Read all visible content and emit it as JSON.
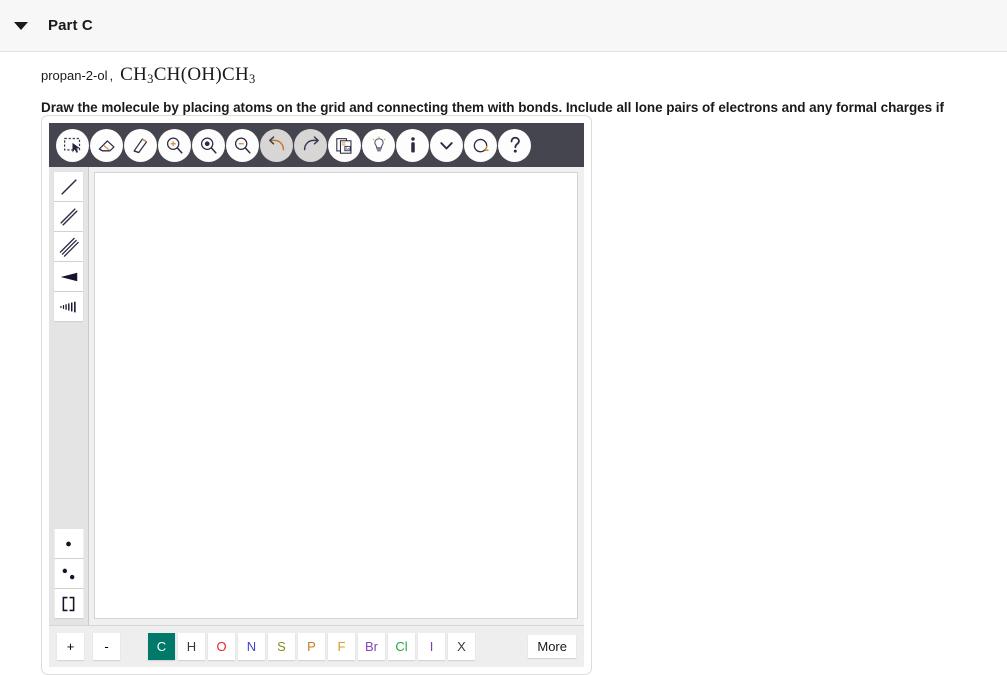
{
  "header": {
    "caret_icon": "caret-down-icon",
    "title": "Part C"
  },
  "prompt": {
    "compound_name": "propan-2-ol",
    "separator": ",",
    "formula_parts": [
      {
        "text": "CH",
        "sub": "3"
      },
      {
        "text": "CH(OH)CH",
        "sub": "3"
      }
    ],
    "formula_plain": "CH3CH(OH)CH3",
    "instruction": "Draw the molecule by placing atoms on the grid and connecting them with bonds. Include all lone pairs of electrons and any formal charges if necessary."
  },
  "editor": {
    "toolbar": [
      {
        "name": "select-lasso-icon",
        "label": "Select",
        "state": "enabled"
      },
      {
        "name": "eraser-icon",
        "label": "Erase",
        "state": "enabled"
      },
      {
        "name": "pencil-draw-icon",
        "label": "Draw",
        "state": "enabled"
      },
      {
        "name": "zoom-in-icon",
        "label": "Zoom In",
        "state": "enabled"
      },
      {
        "name": "zoom-fit-icon",
        "label": "Zoom Fit",
        "state": "enabled"
      },
      {
        "name": "zoom-out-icon",
        "label": "Zoom Out",
        "state": "enabled"
      },
      {
        "name": "undo-icon",
        "label": "Undo",
        "state": "disabled"
      },
      {
        "name": "redo-icon",
        "label": "Redo",
        "state": "enabled"
      },
      {
        "name": "copy-page-icon",
        "label": "Copy",
        "state": "enabled"
      },
      {
        "name": "hint-bulb-icon",
        "label": "Hint",
        "state": "enabled"
      },
      {
        "name": "info-icon",
        "label": "Info",
        "state": "enabled"
      },
      {
        "name": "chevron-down-icon",
        "label": "More Options",
        "state": "enabled"
      },
      {
        "name": "reset-refresh-icon",
        "label": "Reset",
        "state": "enabled"
      },
      {
        "name": "help-question-icon",
        "label": "Help",
        "state": "enabled"
      }
    ],
    "side_tools_top": [
      {
        "name": "single-bond-icon",
        "label": "Single Bond"
      },
      {
        "name": "double-bond-icon",
        "label": "Double Bond"
      },
      {
        "name": "triple-bond-icon",
        "label": "Triple Bond"
      },
      {
        "name": "wedge-bond-icon",
        "label": "Wedge Bond"
      },
      {
        "name": "hash-bond-icon",
        "label": "Hash Bond"
      }
    ],
    "side_tools_bottom": [
      {
        "name": "single-electron-icon",
        "label": "Single Electron"
      },
      {
        "name": "lone-pair-icon",
        "label": "Lone Pair"
      },
      {
        "name": "brackets-icon",
        "label": "Brackets"
      }
    ],
    "canvas": {
      "name": "drawing-canvas",
      "content": ""
    },
    "charge_buttons": [
      {
        "name": "plus-charge-button",
        "label": "+"
      },
      {
        "name": "minus-charge-button",
        "label": "-"
      }
    ],
    "elements": [
      {
        "symbol": "C",
        "color": "#ffffff",
        "selected": true
      },
      {
        "symbol": "H",
        "color": "#3a3a3a",
        "selected": false
      },
      {
        "symbol": "O",
        "color": "#e8222b",
        "selected": false
      },
      {
        "symbol": "N",
        "color": "#4444cc",
        "selected": false
      },
      {
        "symbol": "S",
        "color": "#8a8a22",
        "selected": false
      },
      {
        "symbol": "P",
        "color": "#cc7722",
        "selected": false
      },
      {
        "symbol": "F",
        "color": "#d79b2b",
        "selected": false
      },
      {
        "symbol": "Br",
        "color": "#8844bb",
        "selected": false
      },
      {
        "symbol": "Cl",
        "color": "#22aa44",
        "selected": false
      },
      {
        "symbol": "I",
        "color": "#7744bb",
        "selected": false
      },
      {
        "symbol": "X",
        "color": "#3a3a3a",
        "selected": false
      }
    ],
    "more_label": "More",
    "colors": {
      "toolbar_bg": "#454550",
      "selected_element_bg": "#00796b",
      "side_panel_bg": "#e4e4e4",
      "bottom_bar_bg": "#eeeeee"
    }
  }
}
